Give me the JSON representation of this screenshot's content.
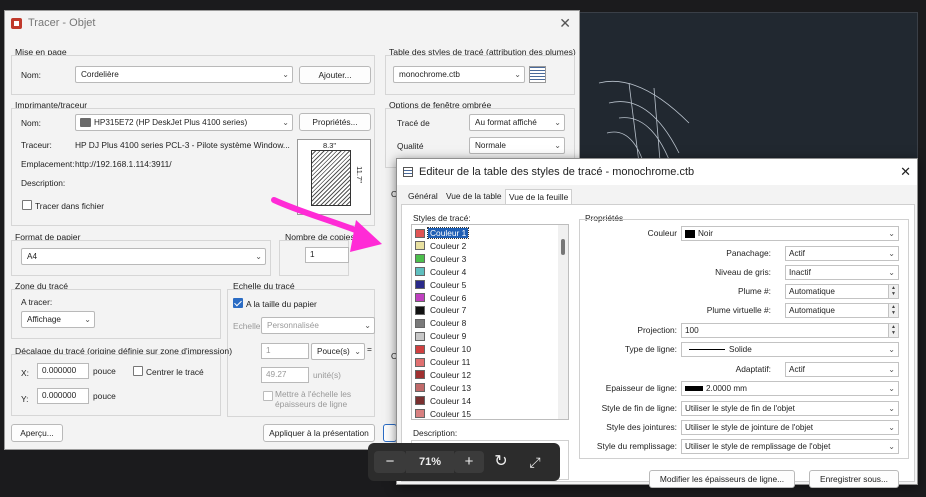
{
  "tracer": {
    "title": "Tracer - Objet",
    "close": "✕",
    "page_setup": {
      "group": "Mise en page",
      "name_label": "Nom:",
      "name_value": "Cordelière",
      "add_button": "Ajouter..."
    },
    "printer": {
      "group": "Imprimante/traceur",
      "name_label": "Nom:",
      "name_value": "HP315E72 (HP DeskJet Plus 4100 series)",
      "properties_button": "Propriétés...",
      "plotter_label": "Traceur:",
      "plotter_value": "HP DJ Plus 4100 series PCL-3 - Pilote système Window...",
      "location_label": "Emplacement:",
      "location_value": "http://192.168.1.114:3911/",
      "description_label": "Description:",
      "plot_to_file": "Tracer dans fichier",
      "preview_width": "8.3\"",
      "preview_height": "11.7\""
    },
    "paper": {
      "group": "Format de papier",
      "value": "A4"
    },
    "copies": {
      "group": "Nombre de copies",
      "value": "1"
    },
    "plot_area": {
      "group": "Zone du tracé",
      "what_label": "A tracer:",
      "what_value": "Affichage"
    },
    "scale": {
      "group": "Echelle du tracé",
      "fit_paper": "A la taille du papier",
      "scale_label": "Echelle:",
      "scale_value": "Personnalisée",
      "value1": "1",
      "unit": "Pouce(s)",
      "value2": "49.27",
      "unit2": "unité(s)",
      "scale_lineweights": "Mettre à l'échelle les épaisseurs de ligne"
    },
    "offset": {
      "group": "Décalage du tracé (origine définie sur zone d'impression)",
      "x_label": "X:",
      "x_value": "0.000000",
      "y_label": "Y:",
      "y_value": "0.000000",
      "unit": "pouce",
      "center": "Centrer le tracé"
    },
    "style_table": {
      "group": "Table des styles de tracé (attribution des plumes)",
      "value": "monochrome.ctb"
    },
    "shaded": {
      "group": "Options de fenêtre ombrée",
      "shade_label": "Tracé de",
      "shade_value": "Au format affiché",
      "quality_label": "Qualité",
      "quality_value": "Normale"
    },
    "preview_button": "Aperçu...",
    "apply_button": "Appliquer à la présentation",
    "cut_o1": "O",
    "cut_o2": "O"
  },
  "editor": {
    "title": "Editeur de la table des styles de tracé - monochrome.ctb",
    "close": "✕",
    "tabs": [
      "Général",
      "Vue de la table",
      "Vue de la feuille"
    ],
    "styles_label": "Styles de tracé:",
    "styles": [
      {
        "name": "Couleur 1",
        "color": "#e05555"
      },
      {
        "name": "Couleur 2",
        "color": "#e8e0a0"
      },
      {
        "name": "Couleur 3",
        "color": "#4cbf4c"
      },
      {
        "name": "Couleur 4",
        "color": "#5fbfbf"
      },
      {
        "name": "Couleur 5",
        "color": "#2a2a8a"
      },
      {
        "name": "Couleur 6",
        "color": "#c040c0"
      },
      {
        "name": "Couleur 7",
        "color": "#111111"
      },
      {
        "name": "Couleur 8",
        "color": "#7a7a7a"
      },
      {
        "name": "Couleur 9",
        "color": "#c8c8c8"
      },
      {
        "name": "Couleur 10",
        "color": "#d04040"
      },
      {
        "name": "Couleur 11",
        "color": "#e07070"
      },
      {
        "name": "Couleur 12",
        "color": "#a03030"
      },
      {
        "name": "Couleur 13",
        "color": "#c06a6a"
      },
      {
        "name": "Couleur 14",
        "color": "#7a3030"
      },
      {
        "name": "Couleur 15",
        "color": "#d88080"
      }
    ],
    "description_label": "Description:",
    "props_label": "Propriétés",
    "props": {
      "color_label": "Couleur",
      "color_value": "Noir",
      "dither_label": "Panachage:",
      "dither_value": "Actif",
      "gray_label": "Niveau de gris:",
      "gray_value": "Inactif",
      "pen_label": "Plume #:",
      "pen_value": "Automatique",
      "vpen_label": "Plume virtuelle #:",
      "vpen_value": "Automatique",
      "proj_label": "Projection:",
      "proj_value": "100",
      "linetype_label": "Type de ligne:",
      "linetype_value": "Solide",
      "adapt_label": "Adaptatif:",
      "adapt_value": "Actif",
      "lw_label": "Epaisseur de ligne:",
      "lw_value": "2.0000 mm",
      "end_label": "Style de fin de ligne:",
      "end_value": "Utiliser le style de fin de l'objet",
      "join_label": "Style des jointures:",
      "join_value": "Utiliser le style de jointure de l'objet",
      "fill_label": "Style du remplissage:",
      "fill_value": "Utiliser le style de remplissage de l'objet"
    },
    "edit_lw_button": "Modifier les épaisseurs de ligne...",
    "save_as_button": "Enregistrer sous..."
  },
  "zoom": {
    "minus": "−",
    "value": "71%",
    "plus": "+"
  },
  "colors": {
    "arrow": "#ff2bd6",
    "selection": "#1f5fb4"
  }
}
